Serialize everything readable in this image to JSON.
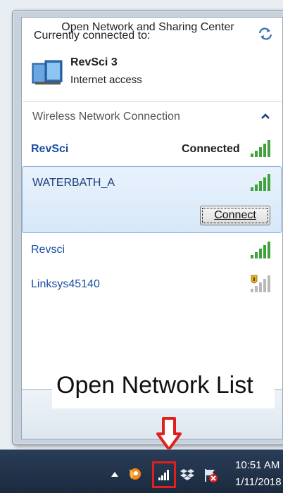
{
  "flyout": {
    "header": "Currently connected to:",
    "current_network": {
      "name": "RevSci  3",
      "status": "Internet access"
    },
    "section_title": "Wireless Network Connection",
    "networks": [
      {
        "name": "RevSci",
        "status": "Connected"
      },
      {
        "name": "WATERBATH_A",
        "button": "Connect"
      },
      {
        "name": "Revsci"
      },
      {
        "name": "Linksys45140"
      }
    ],
    "footer_link": "Open Network and Sharing Center"
  },
  "annotation": {
    "text": "Open Network List"
  },
  "taskbar": {
    "time": "10:51 AM",
    "date": "1/11/2018"
  },
  "colors": {
    "signal": "#3fa23a",
    "link": "#1a4fa0",
    "highlight": "#e0201c"
  },
  "icons": [
    "refresh-icon",
    "computer-network-icon",
    "collapse-chevron-icon",
    "signal-bars-icon",
    "secured-signal-icon",
    "down-arrow-icon",
    "avast-icon",
    "network-tray-icon",
    "dropbox-icon",
    "action-center-flag-icon"
  ]
}
